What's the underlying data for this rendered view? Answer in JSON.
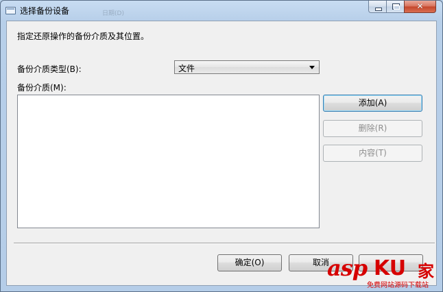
{
  "window": {
    "title": "选择备份设备",
    "ghost_text": [
      "",
      "日期(D)"
    ]
  },
  "caption_buttons": {
    "close_glyph": "✕"
  },
  "dialog": {
    "instruction": "指定还原操作的备份介质及其位置。",
    "media_type_label": "备份介质类型(B):",
    "media_type_value": "文件",
    "media_label": "备份介质(M):",
    "media_items": []
  },
  "buttons": {
    "add": "添加(A)",
    "remove": "删除(R)",
    "contents": "内容(T)",
    "ok": "确定(O)",
    "cancel": "取消"
  },
  "watermark": {
    "brand_asp": "asp",
    "brand_ku": "KU",
    "brand_jia": "家",
    "tagline": "免费网站源码下载站"
  },
  "colors": {
    "accent": "#3c7fb1",
    "close_red": "#c3452a",
    "watermark_red": "#d60000"
  }
}
